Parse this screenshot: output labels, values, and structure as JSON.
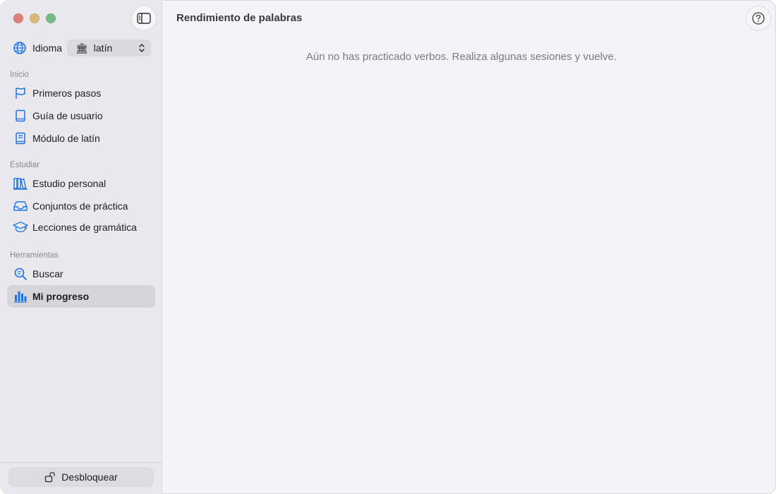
{
  "window": {
    "traffic_colors": [
      "#d9807a",
      "#d9b77a",
      "#7ab98a"
    ]
  },
  "sidebar": {
    "language_label": "Idioma",
    "language_value": "latín",
    "sections": [
      {
        "title": "Inicio",
        "items": [
          {
            "label": "Primeros pasos",
            "icon": "flag-icon"
          },
          {
            "label": "Guía de usuario",
            "icon": "book-icon"
          },
          {
            "label": "Módulo de latín",
            "icon": "module-book-icon"
          }
        ]
      },
      {
        "title": "Estudiar",
        "items": [
          {
            "label": "Estudio personal",
            "icon": "books-icon"
          },
          {
            "label": "Conjuntos de práctica",
            "icon": "tray-icon"
          },
          {
            "label": "Lecciones de gramática",
            "icon": "graduation-cap-icon"
          }
        ]
      },
      {
        "title": "Herramientas",
        "items": [
          {
            "label": "Buscar",
            "icon": "search-icon"
          },
          {
            "label": "Mi progreso",
            "icon": "bar-chart-icon",
            "active": true
          }
        ]
      }
    ],
    "unlock_label": "Desbloquear"
  },
  "main": {
    "title": "Rendimiento de palabras",
    "empty_message": "Aún no has practicado verbos. Realiza algunas sesiones y vuelve."
  },
  "colors": {
    "accent": "#1a73e8",
    "sidebar_bg": "#e9e8ed",
    "main_bg": "#f4f3f8"
  }
}
